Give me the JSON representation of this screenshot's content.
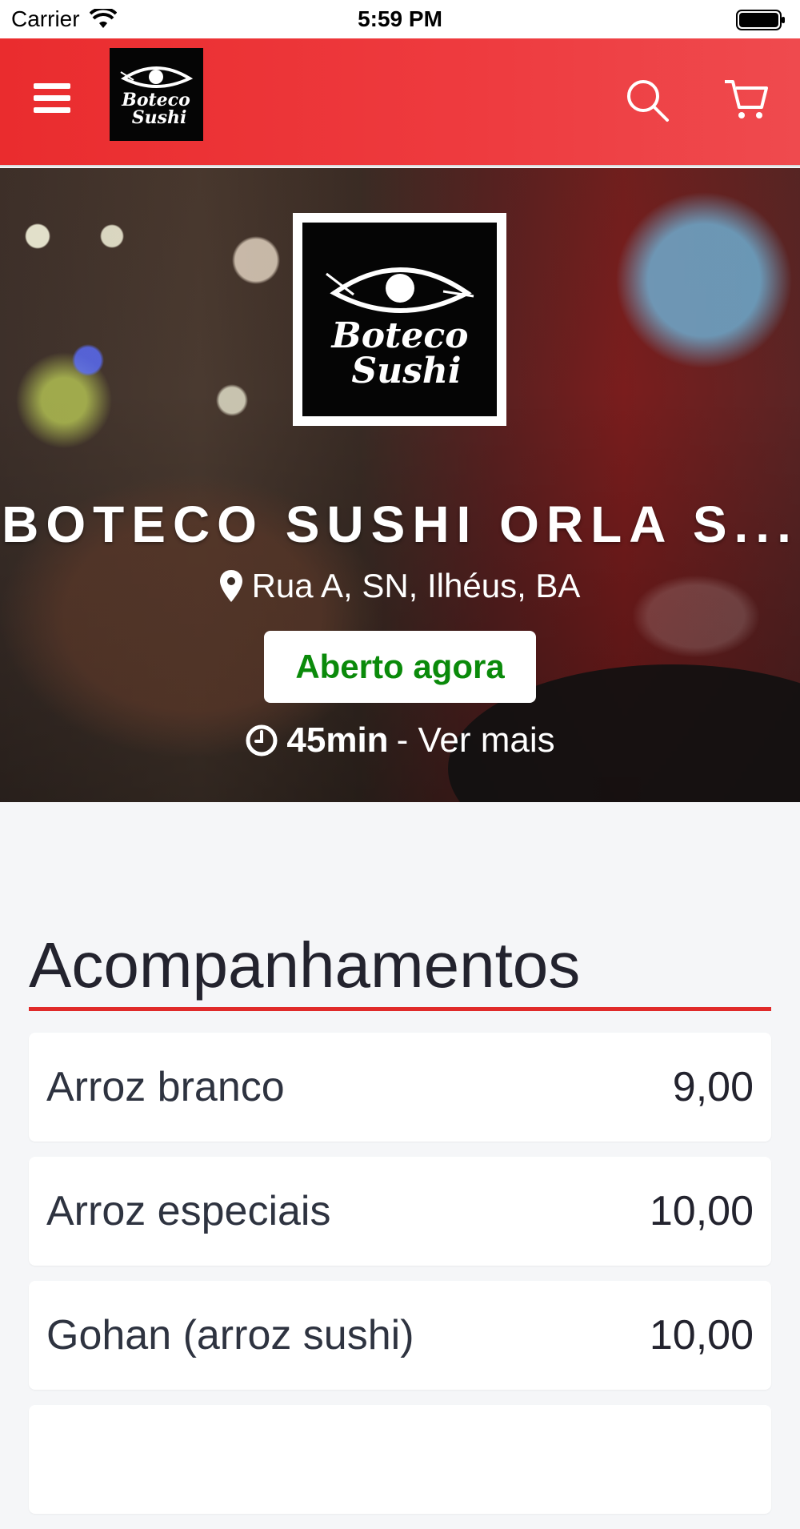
{
  "status_bar": {
    "carrier": "Carrier",
    "time": "5:59 PM"
  },
  "header": {
    "menu_icon": "hamburger-menu-icon",
    "search_icon": "search-icon",
    "cart_icon": "cart-icon",
    "brand_color": "#ea2c2e"
  },
  "hero": {
    "title": "BOTECO SUSHI ORLA S...",
    "address": "Rua A, SN, Ilhéus, BA",
    "status": "Aberto agora",
    "status_color": "#0a8a0a",
    "delivery_time": "45min",
    "see_more": "- Ver mais"
  },
  "section": {
    "title": "Acompanhamentos",
    "accent_color": "#e02a2a",
    "items": [
      {
        "name": "Arroz branco",
        "price": "9,00"
      },
      {
        "name": "Arroz especiais",
        "price": "10,00"
      },
      {
        "name": "Gohan (arroz sushi)",
        "price": "10,00"
      }
    ]
  }
}
